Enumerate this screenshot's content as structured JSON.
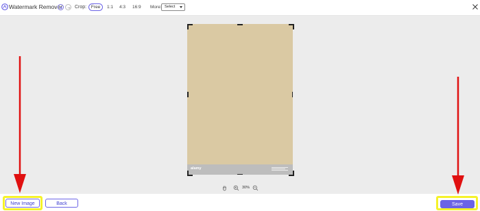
{
  "app": {
    "title": "Watermark Remover"
  },
  "toolbar": {
    "crop_label": "Crop:",
    "crop_options": [
      "Free",
      "1:1",
      "4:3",
      "16:9"
    ],
    "more_label": "More:",
    "select_value": "Select"
  },
  "canvas": {
    "watermark_text": "alamy",
    "zoom": "30%"
  },
  "footer": {
    "new_image_label": "New Image",
    "back_label": "Back",
    "save_label": "Save"
  },
  "colors": {
    "accent": "#6b63e6",
    "highlight": "#f5f22a",
    "arrow": "#e01010",
    "image_fill": "#dac9a3"
  }
}
